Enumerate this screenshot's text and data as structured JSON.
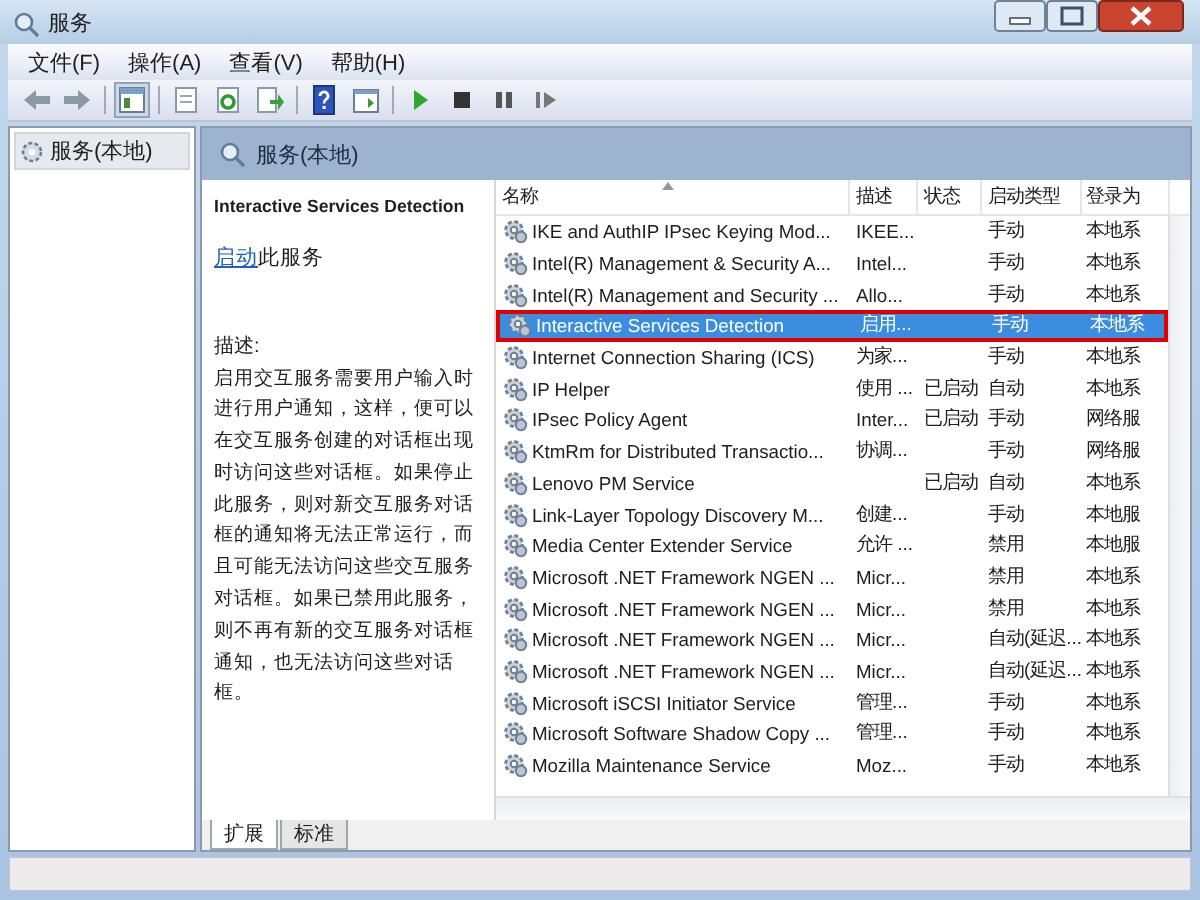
{
  "window": {
    "title": "服务"
  },
  "menu": [
    "文件(F)",
    "操作(A)",
    "查看(V)",
    "帮助(H)"
  ],
  "toolbar": [
    {
      "kind": "back"
    },
    {
      "kind": "forward"
    },
    {
      "kind": "sep"
    },
    {
      "kind": "pane",
      "selected": true
    },
    {
      "kind": "sep"
    },
    {
      "kind": "sheet"
    },
    {
      "kind": "refresh"
    },
    {
      "kind": "export"
    },
    {
      "kind": "sep"
    },
    {
      "kind": "help"
    },
    {
      "kind": "panel"
    },
    {
      "kind": "sep"
    },
    {
      "kind": "play"
    },
    {
      "kind": "stop"
    },
    {
      "kind": "pause"
    },
    {
      "kind": "resume"
    }
  ],
  "tree": [
    {
      "label": "服务(本地)",
      "selected": true
    }
  ],
  "pane_header": "服务(本地)",
  "detail": {
    "title": "Interactive Services Detection",
    "action_link": "启动",
    "action_text": "此服务",
    "description_label": "描述:",
    "description": "启用交互服务需要用户输入时进行用户通知，这样，便可以在交互服务创建的对话框出现时访问这些对话框。如果停止此服务，则对新交互服务对话框的通知将无法正常运行，而且可能无法访问这些交互服务对话框。如果已禁用此服务，则不再有新的交互服务对话框通知，也无法访问这些对话框。"
  },
  "table": {
    "columns": [
      "名称",
      "描述",
      "状态",
      "启动类型",
      "登录为"
    ],
    "rows": [
      {
        "cells": [
          "IKE and AuthIP IPsec Keying Mod...",
          "IKEE...",
          "",
          "手动",
          "本地系"
        ],
        "selected": false,
        "outlined": false
      },
      {
        "cells": [
          "Intel(R) Management & Security A...",
          "Intel...",
          "",
          "手动",
          "本地系"
        ],
        "selected": false,
        "outlined": false
      },
      {
        "cells": [
          "Intel(R) Management and Security ...",
          "Allo...",
          "",
          "手动",
          "本地系"
        ],
        "selected": false,
        "outlined": false
      },
      {
        "cells": [
          "Interactive Services Detection",
          "启用...",
          "",
          "手动",
          "本地系"
        ],
        "selected": true,
        "outlined": true
      },
      {
        "cells": [
          "Internet Connection Sharing (ICS)",
          "为家...",
          "",
          "手动",
          "本地系"
        ],
        "selected": false,
        "outlined": false
      },
      {
        "cells": [
          "IP Helper",
          "使用 ...",
          "已启动",
          "自动",
          "本地系"
        ],
        "selected": false,
        "outlined": false
      },
      {
        "cells": [
          "IPsec Policy Agent",
          "Inter...",
          "已启动",
          "手动",
          "网络服"
        ],
        "selected": false,
        "outlined": false
      },
      {
        "cells": [
          "KtmRm for Distributed Transactio...",
          "协调...",
          "",
          "手动",
          "网络服"
        ],
        "selected": false,
        "outlined": false
      },
      {
        "cells": [
          "Lenovo PM Service",
          "",
          "已启动",
          "自动",
          "本地系"
        ],
        "selected": false,
        "outlined": false
      },
      {
        "cells": [
          "Link-Layer Topology Discovery M...",
          "创建...",
          "",
          "手动",
          "本地服"
        ],
        "selected": false,
        "outlined": false
      },
      {
        "cells": [
          "Media Center Extender Service",
          "允许 ...",
          "",
          "禁用",
          "本地服"
        ],
        "selected": false,
        "outlined": false
      },
      {
        "cells": [
          "Microsoft .NET Framework NGEN ...",
          "Micr...",
          "",
          "禁用",
          "本地系"
        ],
        "selected": false,
        "outlined": false
      },
      {
        "cells": [
          "Microsoft .NET Framework NGEN ...",
          "Micr...",
          "",
          "禁用",
          "本地系"
        ],
        "selected": false,
        "outlined": false
      },
      {
        "cells": [
          "Microsoft .NET Framework NGEN ...",
          "Micr...",
          "",
          "自动(延迟...",
          "本地系"
        ],
        "selected": false,
        "outlined": false
      },
      {
        "cells": [
          "Microsoft .NET Framework NGEN ...",
          "Micr...",
          "",
          "自动(延迟...",
          "本地系"
        ],
        "selected": false,
        "outlined": false
      },
      {
        "cells": [
          "Microsoft iSCSI Initiator Service",
          "管理...",
          "",
          "手动",
          "本地系"
        ],
        "selected": false,
        "outlined": false
      },
      {
        "cells": [
          "Microsoft Software Shadow Copy ...",
          "管理...",
          "",
          "手动",
          "本地系"
        ],
        "selected": false,
        "outlined": false
      },
      {
        "cells": [
          "Mozilla Maintenance Service",
          "Moz...",
          "",
          "手动",
          "本地系"
        ],
        "selected": false,
        "outlined": false
      }
    ]
  },
  "tabs": [
    {
      "label": "扩展",
      "selected": true
    },
    {
      "label": "标准",
      "selected": false
    }
  ]
}
